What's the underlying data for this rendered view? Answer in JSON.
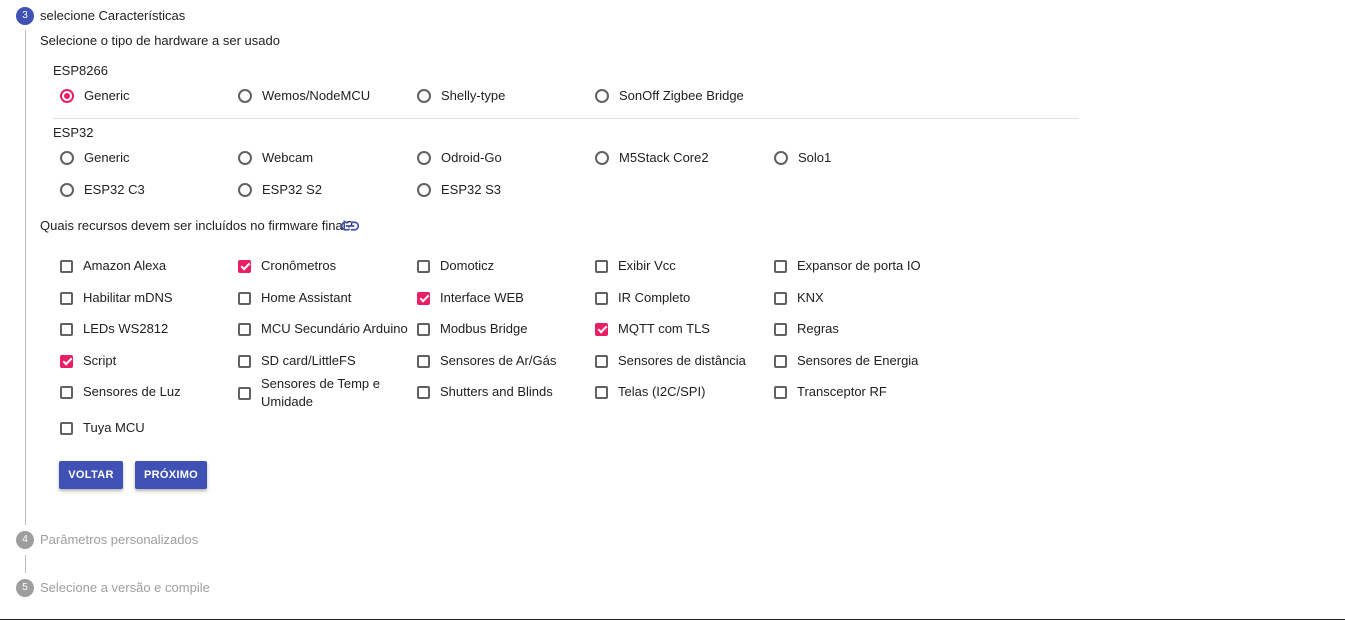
{
  "steps": {
    "current": {
      "number": "3",
      "title": "selecione Características"
    },
    "next": {
      "number": "4",
      "title": "Parâmetros personalizados"
    },
    "last": {
      "number": "5",
      "title": "Selecione a versão e compile"
    }
  },
  "hardware": {
    "prompt": "Selecione o tipo de hardware a ser usado",
    "esp8266": {
      "label": "ESP8266",
      "options": [
        "Generic",
        "Wemos/NodeMCU",
        "Shelly-type",
        "SonOff Zigbee Bridge"
      ],
      "selected": "Generic"
    },
    "esp32": {
      "label": "ESP32",
      "options": [
        "Generic",
        "Webcam",
        "Odroid-Go",
        "M5Stack Core2",
        "Solo1",
        "ESP32 C3",
        "ESP32 S2",
        "ESP32 S3"
      ]
    }
  },
  "features": {
    "prompt": "Quais recursos devem ser incluídos no firmware final?",
    "link_icon": "link-icon",
    "items": [
      {
        "label": "Amazon Alexa",
        "checked": false
      },
      {
        "label": "Cronômetros",
        "checked": true
      },
      {
        "label": "Domoticz",
        "checked": false
      },
      {
        "label": "Exibir Vcc",
        "checked": false
      },
      {
        "label": "Expansor de porta IO",
        "checked": false
      },
      {
        "label": "Habilitar mDNS",
        "checked": false
      },
      {
        "label": "Home Assistant",
        "checked": false
      },
      {
        "label": "Interface WEB",
        "checked": true
      },
      {
        "label": "IR Completo",
        "checked": false
      },
      {
        "label": "KNX",
        "checked": false
      },
      {
        "label": "LEDs WS2812",
        "checked": false
      },
      {
        "label": "MCU Secundário Arduino",
        "checked": false
      },
      {
        "label": "Modbus Bridge",
        "checked": false
      },
      {
        "label": "MQTT com TLS",
        "checked": true
      },
      {
        "label": "Regras",
        "checked": false
      },
      {
        "label": "Script",
        "checked": true
      },
      {
        "label": "SD card/LittleFS",
        "checked": false
      },
      {
        "label": "Sensores de Ar/Gás",
        "checked": false
      },
      {
        "label": "Sensores de distância",
        "checked": false
      },
      {
        "label": "Sensores de Energia",
        "checked": false
      },
      {
        "label": "Sensores de Luz",
        "checked": false
      },
      {
        "label": "Sensores de Temp e Umidade",
        "checked": false
      },
      {
        "label": "Shutters and Blinds",
        "checked": false
      },
      {
        "label": "Telas (I2C/SPI)",
        "checked": false
      },
      {
        "label": "Transceptor RF",
        "checked": false
      },
      {
        "label": "Tuya MCU",
        "checked": false
      }
    ]
  },
  "buttons": {
    "back": "VOLTAR",
    "next": "PRÓXIMO"
  },
  "colors": {
    "primary": "#3f51b5",
    "accent": "#e91e63",
    "inactive": "#9e9e9e"
  }
}
